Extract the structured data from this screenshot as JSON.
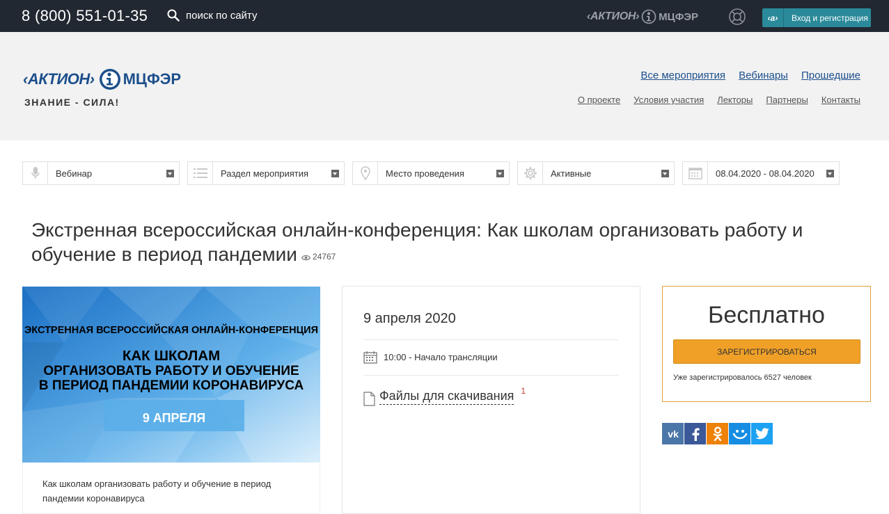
{
  "topbar": {
    "phone": "8 (800) 551-01-35",
    "search_label": "поиск по сайту",
    "logo_aktion": "‹АКТИОН›",
    "logo_mcfer": "МЦФЭР",
    "login_icon_text": "‹а›",
    "login_label": "Вход и регистрация"
  },
  "header": {
    "logo_aktion": "‹АКТИОН›",
    "logo_mcfer": "МЦФЭР",
    "tagline": "ЗНАНИЕ - СИЛА!",
    "nav_primary": [
      "Все мероприятия",
      "Вебинары",
      "Прошедшие"
    ],
    "nav_secondary": [
      "О проекте",
      "Условия участия",
      "Лекторы",
      "Партнеры",
      "Контакты"
    ]
  },
  "filters": [
    {
      "icon": "microphone-icon",
      "label": "Вебинар"
    },
    {
      "icon": "list-icon",
      "label": "Раздел мероприятия"
    },
    {
      "icon": "location-pin-icon",
      "label": "Место проведения"
    },
    {
      "icon": "gear-icon",
      "label": "Активные"
    },
    {
      "icon": "calendar-icon",
      "label": "08.04.2020 - 08.04.2020"
    }
  ],
  "event": {
    "title": "Экстренная всероссийская онлайн-конференция: Как школам организовать работу и обучение в период пандемии",
    "views": "24767"
  },
  "banner": {
    "line1": "ЭКСТРЕННАЯ ВСЕРОССИЙСКАЯ ОНЛАЙН-КОНФЕРЕНЦИЯ",
    "line2": "КАК ШКОЛАМ",
    "line3": "ОРГАНИЗОВАТЬ РАБОТУ И ОБУЧЕНИЕ",
    "line4": "В ПЕРИОД ПАНДЕМИИ КОРОНАВИРУСА",
    "date": "9 АПРЕЛЯ",
    "caption": "Как школам организовать работу и обучение в период пандемии коронавируса"
  },
  "details": {
    "date": "9 апреля 2020",
    "time": "10:00 - Начало трансляции",
    "files_label": "Файлы для скачивания",
    "files_count": "1"
  },
  "registration": {
    "price": "Бесплатно",
    "button": "ЗАРЕГИСТРИРОВАТЬСЯ",
    "registered": "Уже зарегистрировалось 6527 человек"
  },
  "social": [
    {
      "name": "vk",
      "label": "vk",
      "color": "#4a76a8"
    },
    {
      "name": "facebook",
      "label": "f",
      "color": "#3b5998"
    },
    {
      "name": "odnoklassniki",
      "label": "ok",
      "color": "#ee8208"
    },
    {
      "name": "moimir",
      "label": "@",
      "color": "#168de2"
    },
    {
      "name": "twitter",
      "label": "tw",
      "color": "#1da1f2"
    }
  ],
  "colors": {
    "topbar_bg": "#222831",
    "accent_teal": "#2a8a9a",
    "brand_blue": "#1c4f8c",
    "register_orange": "#f0a027"
  }
}
